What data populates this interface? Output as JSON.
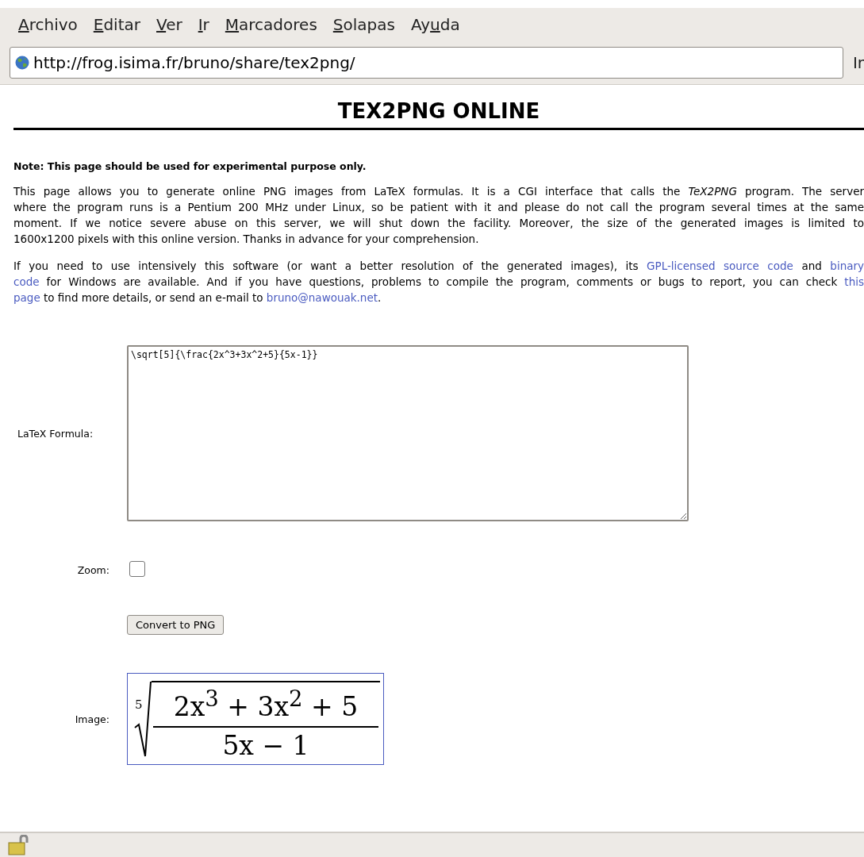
{
  "menu": [
    {
      "key": "A",
      "rest": "rchivo"
    },
    {
      "key": "E",
      "rest": "ditar"
    },
    {
      "key": "V",
      "rest": "er"
    },
    {
      "key": "I",
      "rest": "r"
    },
    {
      "key": "M",
      "rest": "arcadores"
    },
    {
      "key": "S",
      "rest": "olapas"
    },
    {
      "before": "Ay",
      "key": "u",
      "rest": "da"
    }
  ],
  "address_bar": {
    "value": "http://frog.isima.fr/bruno/share/tex2png/",
    "go_button": "Ir"
  },
  "page": {
    "title": "TEX2PNG ONLINE",
    "note": "Note: This page should be used for experimental purpose only.",
    "paragraph_1": [
      [
        {
          "text": "This page allows you to generate online PNG images from LaTeX formulas. It is a CGI interface that calls the *TeX2PNG* program. The server"
        }
      ],
      [
        {
          "text": "where the program runs is a Pentium 200 MHz under Linux, so be patient with it and please do not call the program several times at the same"
        }
      ],
      [
        {
          "text": "moment. If we notice severe abuse on this server, we will shut down the facility. Moreover, the size of the generated images is limited to"
        }
      ],
      [
        {
          "text": "1600x1200 pixels with this online version. Thanks in advance for your comprehension."
        }
      ]
    ],
    "paragraph_2": [
      [
        {
          "text": "If you need to use intensively this software (or want a better resolution of the generated images), its "
        },
        {
          "text": "GPL-licensed source code",
          "link": true
        },
        {
          "text": " and "
        },
        {
          "text": "binary",
          "link": true
        }
      ],
      [
        {
          "text": "code",
          "link": true
        },
        {
          "text": " for Windows are available. And if you have questions, problems to compile the program, comments or bugs to report, you can check "
        },
        {
          "text": "this",
          "link": true
        }
      ],
      [
        {
          "text": "page",
          "link": true
        },
        {
          "text": " to find more details, or send an e-mail to "
        },
        {
          "text": "bruno@nawouak.net",
          "link": true
        },
        {
          "text": "."
        }
      ]
    ],
    "form": {
      "formula_label": "LaTeX Formula:",
      "formula_value": "\\sqrt[5]{\\frac{2x^3+3x^2+5}{5x-1}}",
      "zoom_label": "Zoom:",
      "zoom_checked": false,
      "submit": "Convert to PNG",
      "image_label": "Image:",
      "image": {
        "root_index": "5",
        "numerator": "2x$^{3}$ + 3x$^{2}$ + 5",
        "denominator": "5x − 1"
      }
    }
  }
}
